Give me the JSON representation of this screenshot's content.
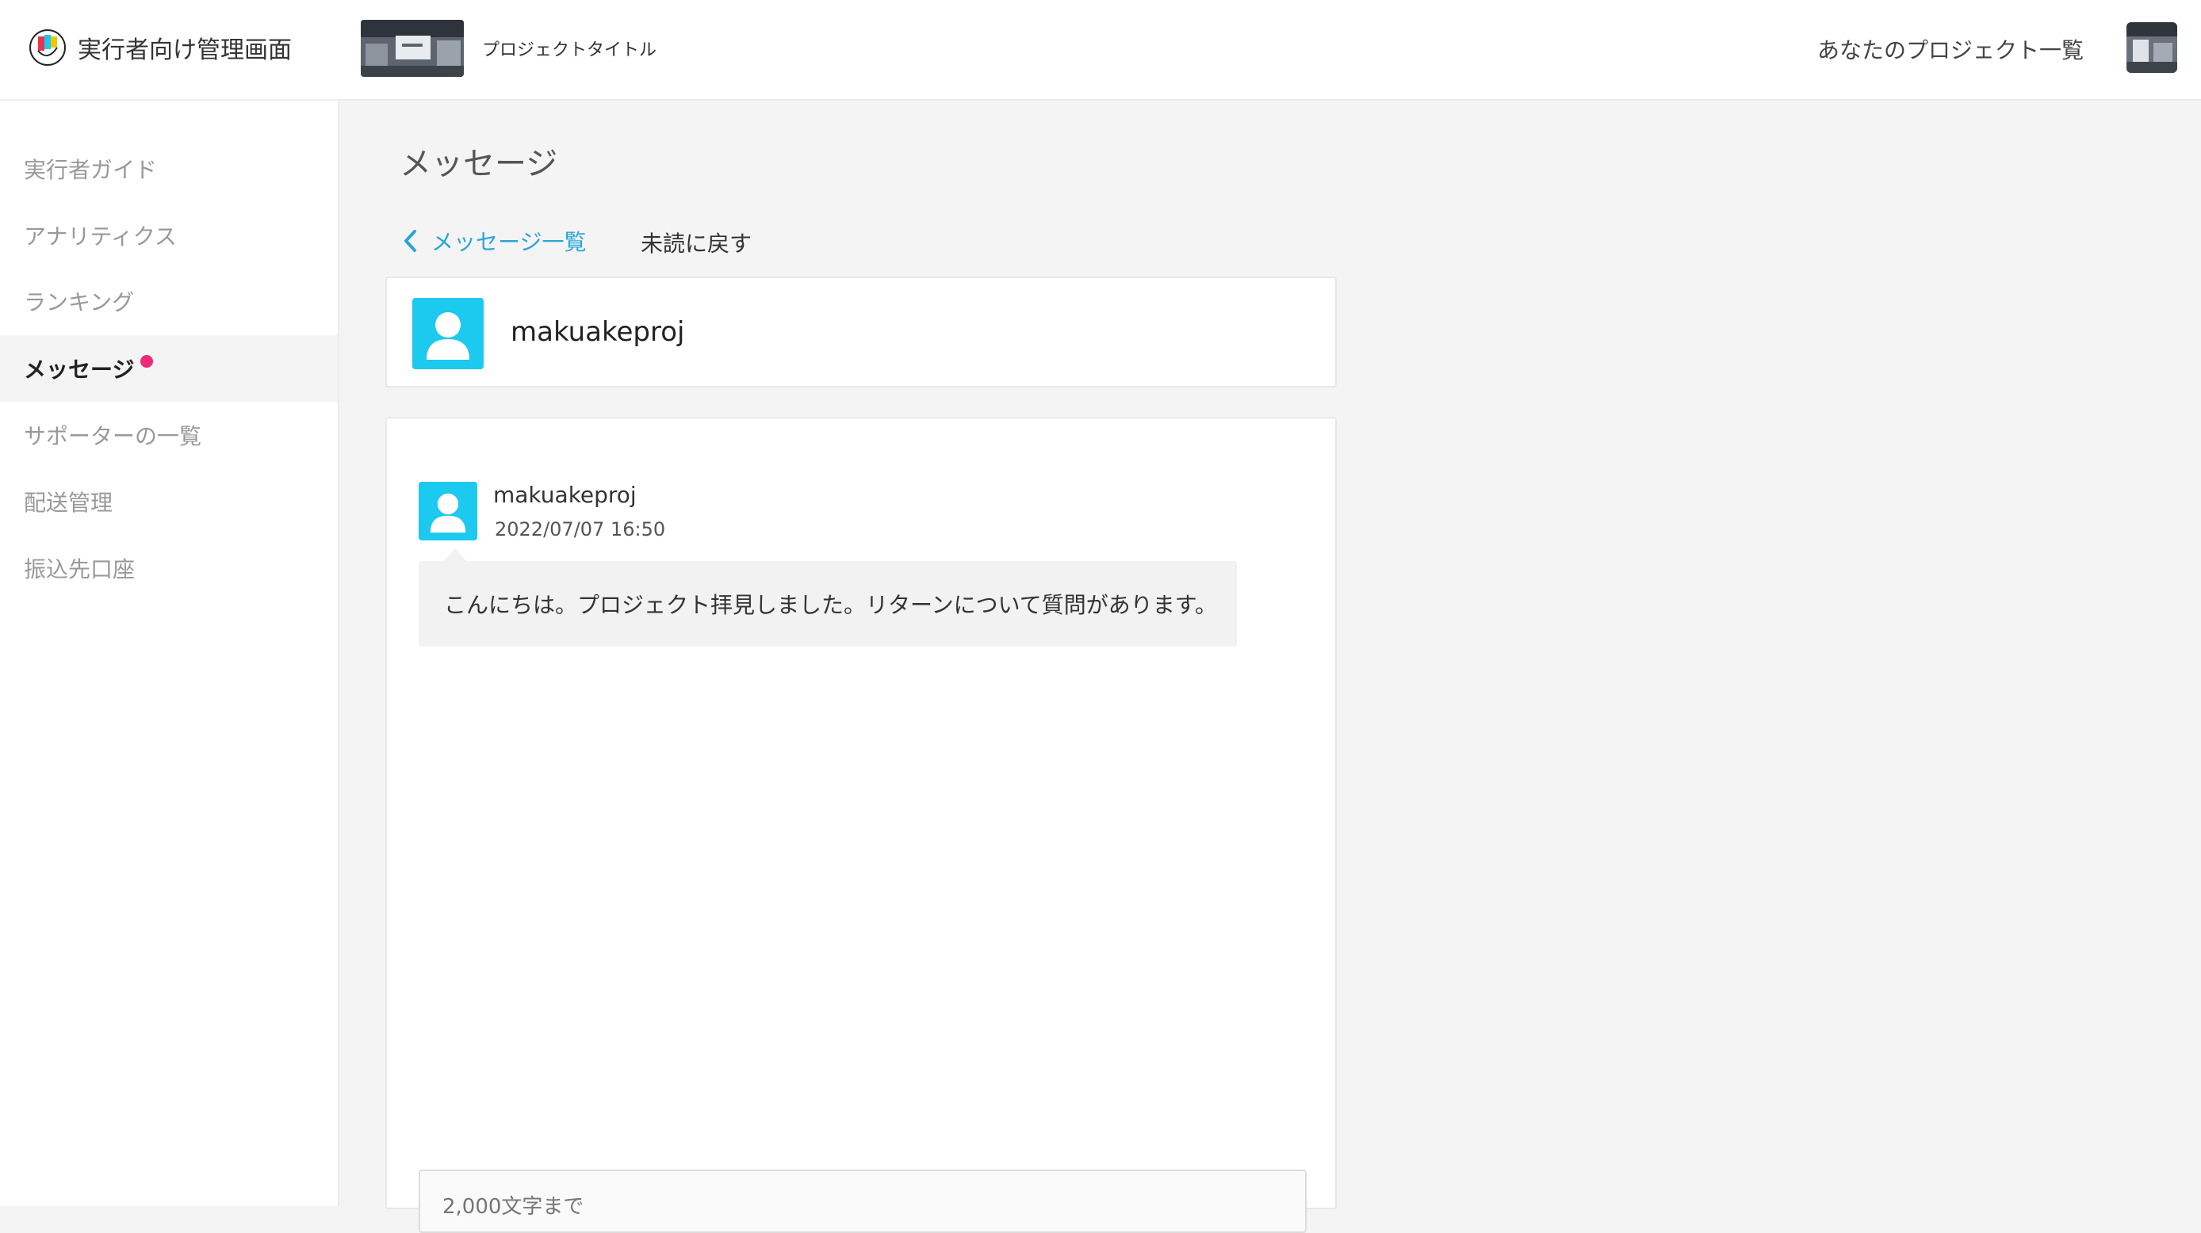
{
  "header": {
    "app_title": "実行者向け管理画面",
    "project_title": "プロジェクトタイトル",
    "project_list_link": "あなたのプロジェクト一覧"
  },
  "sidebar": {
    "items": [
      {
        "label": "実行者ガイド"
      },
      {
        "label": "アナリティクス"
      },
      {
        "label": "ランキング"
      },
      {
        "label": "メッセージ",
        "active": true,
        "has_notification": true
      },
      {
        "label": "サポーターの一覧"
      },
      {
        "label": "配送管理"
      },
      {
        "label": "振込先口座"
      }
    ]
  },
  "main": {
    "page_title": "メッセージ",
    "back_link": "メッセージ一覧",
    "mark_unread": "未読に戻す",
    "recipient": {
      "name": "makuakeproj"
    },
    "messages": [
      {
        "sender": "makuakeproj",
        "timestamp": "2022/07/07 16:50",
        "body": "こんにちは。プロジェクト拝見しました。リターンについて質問があります。"
      }
    ],
    "reply_placeholder": "2,000文字まで"
  },
  "colors": {
    "accent_link": "#2ba5d8",
    "avatar_bg": "#1cc9ef",
    "notification_dot": "#f0287a"
  }
}
